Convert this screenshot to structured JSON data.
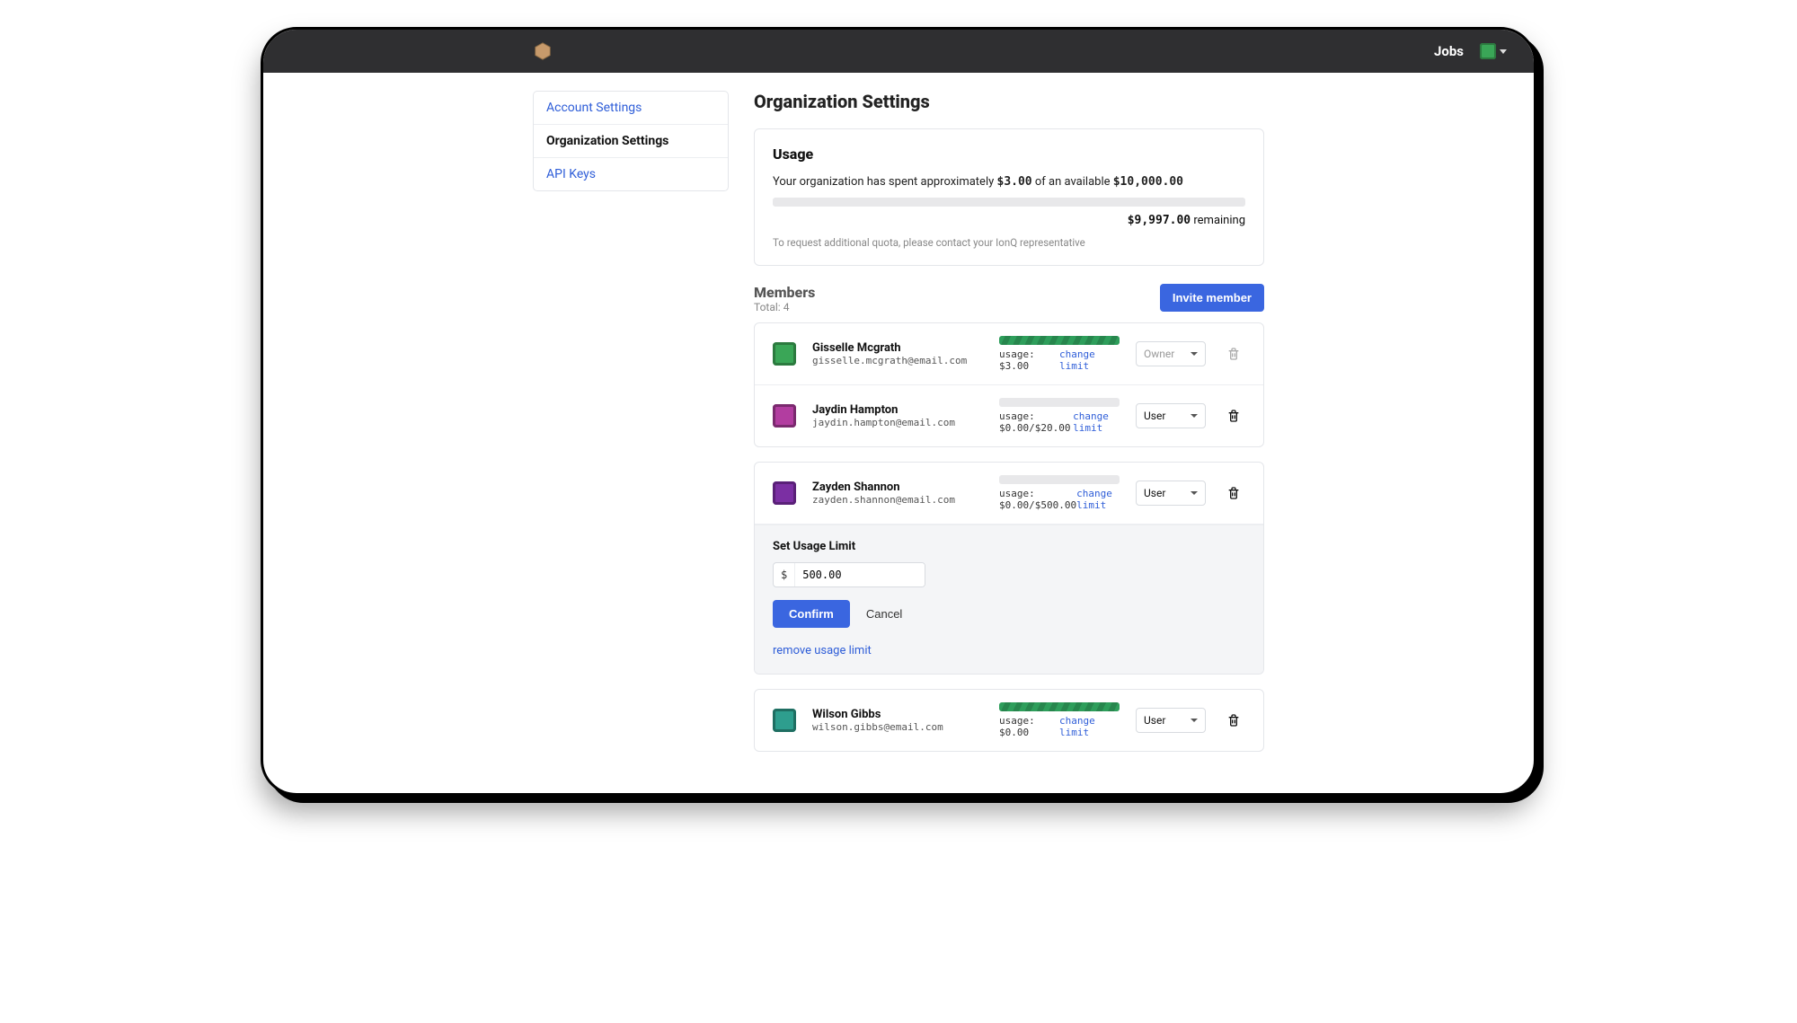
{
  "nav": {
    "jobs": "Jobs"
  },
  "sidebar": {
    "items": [
      {
        "label": "Account Settings"
      },
      {
        "label": "Organization Settings"
      },
      {
        "label": "API Keys"
      }
    ]
  },
  "page": {
    "title": "Organization Settings"
  },
  "usage": {
    "title": "Usage",
    "sentence_prefix": "Your organization has spent approximately ",
    "spent": "$3.00",
    "sentence_mid": " of an available ",
    "available": "$10,000.00",
    "remaining_amount": "$9,997.00",
    "remaining_suffix": " remaining",
    "quota_note": "To request additional quota, please contact your IonQ representative"
  },
  "members_section": {
    "title": "Members",
    "total_label": "Total: ",
    "total_value": "4",
    "invite_label": "Invite member"
  },
  "limit_editor": {
    "title": "Set Usage Limit",
    "currency": "$",
    "value": "500.00",
    "confirm": "Confirm",
    "cancel": "Cancel",
    "remove": "remove usage limit"
  },
  "members": [
    {
      "name": "Gisselle Mcgrath",
      "email": "gisselle.mcgrath@email.com",
      "usage_text": "usage: $3.00",
      "change_label": "change limit",
      "role": "Owner",
      "fill_pct": 100,
      "deletable": false,
      "avatar_bg": "#3aa657"
    },
    {
      "name": "Jaydin Hampton",
      "email": "jaydin.hampton@email.com",
      "usage_text": "usage: $0.00/$20.00",
      "change_label": "change limit",
      "role": "User",
      "fill_pct": 0,
      "deletable": true,
      "avatar_bg": "#b23da0"
    },
    {
      "name": "Zayden Shannon",
      "email": "zayden.shannon@email.com",
      "usage_text": "usage: $0.00/$500.00",
      "change_label": "change limit",
      "role": "User",
      "fill_pct": 0,
      "deletable": true,
      "avatar_bg": "#7b2fa3"
    },
    {
      "name": "Wilson Gibbs",
      "email": "wilson.gibbs@email.com",
      "usage_text": "usage: $0.00",
      "change_label": "change limit",
      "role": "User",
      "fill_pct": 100,
      "deletable": true,
      "avatar_bg": "#2e9e8e"
    }
  ]
}
